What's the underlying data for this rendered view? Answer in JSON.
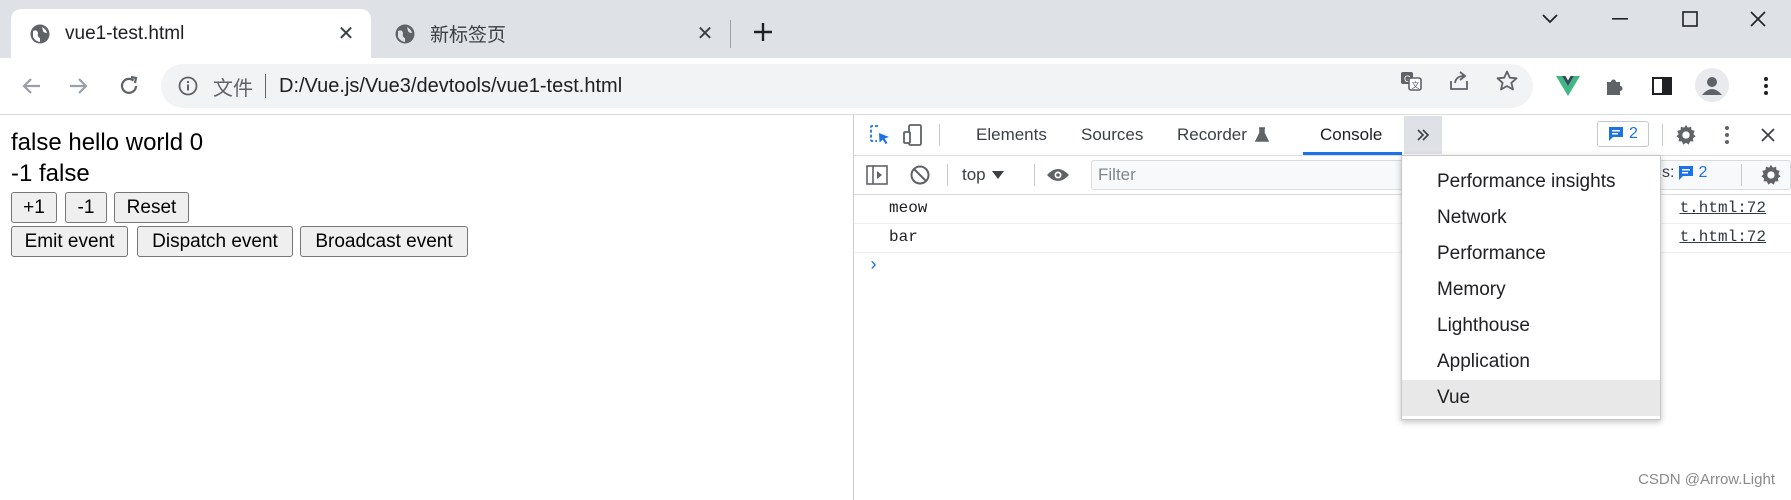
{
  "tabs": [
    {
      "title": "vue1-test.html",
      "active": true
    },
    {
      "title": "新标签页",
      "active": false
    }
  ],
  "address_bar": {
    "scheme_label": "文件",
    "url": "D:/Vue.js/Vue3/devtools/vue1-test.html"
  },
  "page": {
    "line1": "false hello world 0",
    "line2": "-1 false",
    "buttons_row1": [
      "+1",
      "-1",
      "Reset"
    ],
    "buttons_row2": [
      "Emit event",
      "Dispatch event",
      "Broadcast event"
    ]
  },
  "devtools": {
    "tabs": [
      "Elements",
      "Sources",
      "Recorder",
      "Console"
    ],
    "active_tab": "Console",
    "issues_count": "2",
    "context": "top",
    "filter_placeholder": "Filter",
    "issues_label": "s:",
    "issues_count_right": "2",
    "console_rows": [
      {
        "message": "meow",
        "source": "t.html:72"
      },
      {
        "message": "bar",
        "source": "t.html:72"
      }
    ],
    "prompt": "›"
  },
  "more_tabs_menu": {
    "items": [
      "Performance insights",
      "Network",
      "Performance",
      "Memory",
      "Lighthouse",
      "Application",
      "Vue"
    ],
    "highlighted": "Vue"
  },
  "watermark": "CSDN @Arrow.Light",
  "colors": {
    "accent": "#1a73e8",
    "tabstrip_bg": "#dee1e6",
    "vue_green": "#41b883"
  }
}
